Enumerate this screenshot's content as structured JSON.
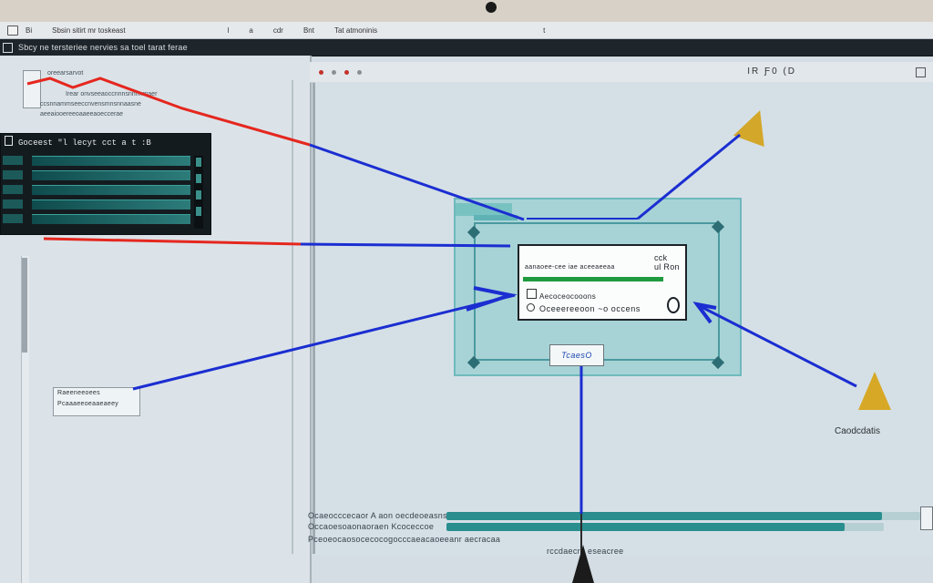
{
  "titlebar": {
    "items": [
      "Bi",
      "Sbsin sitirt mr toskeast",
      "l",
      "a",
      "cdr",
      "Bnt",
      "Tat atmoninis",
      "t"
    ]
  },
  "menubar": {
    "text": "Sbcy ne tersteriee nervies sa toel tarat ferae"
  },
  "toolbar": {
    "right_text": "IR Ƒ0 (D"
  },
  "left_panel": {
    "header_line1": "oreearsarvot",
    "header_line2": "Irear onvseeaoccnnnsnnnnmaer",
    "header_line3": "ccsnnammseeccnvensmnsnnaasne",
    "header_line4": "aeeaiooereeoaaeeaoeccerae"
  },
  "dark_panel": {
    "title": "Goceest \"l lecyt cct a  t :B"
  },
  "info_card": {
    "top_text": "aanaoee-cee iae aceeaeeaa",
    "badge_line1": "cck",
    "badge_line2": "ul Ron",
    "line2": "Aecoceocooons",
    "line3": "Oceeereeoon ~o occens"
  },
  "tag": "TcaesO",
  "source_box": {
    "line1": "Raeeneeoees",
    "line2": "Pcaaaeeoeaaeaeey"
  },
  "candidates_label": "Caodcdatis",
  "bottom": {
    "row1": "Ocaeocccecaor A aon oecdeoeasns",
    "row2": "Occaoesoaonaoraen Kcoceccoe",
    "row3": "Pceoeocaosocecocogocccaeacaoeeanr aecracaa",
    "row4": "rccdaecre eseacree",
    "row1_progress": 0.92,
    "row2_progress": 0.91
  },
  "colors": {
    "accent_teal": "#2a8e8f",
    "wire_blue": "#1b2ed1",
    "wire_red": "#e5271f",
    "success_green": "#1f9a3e"
  }
}
